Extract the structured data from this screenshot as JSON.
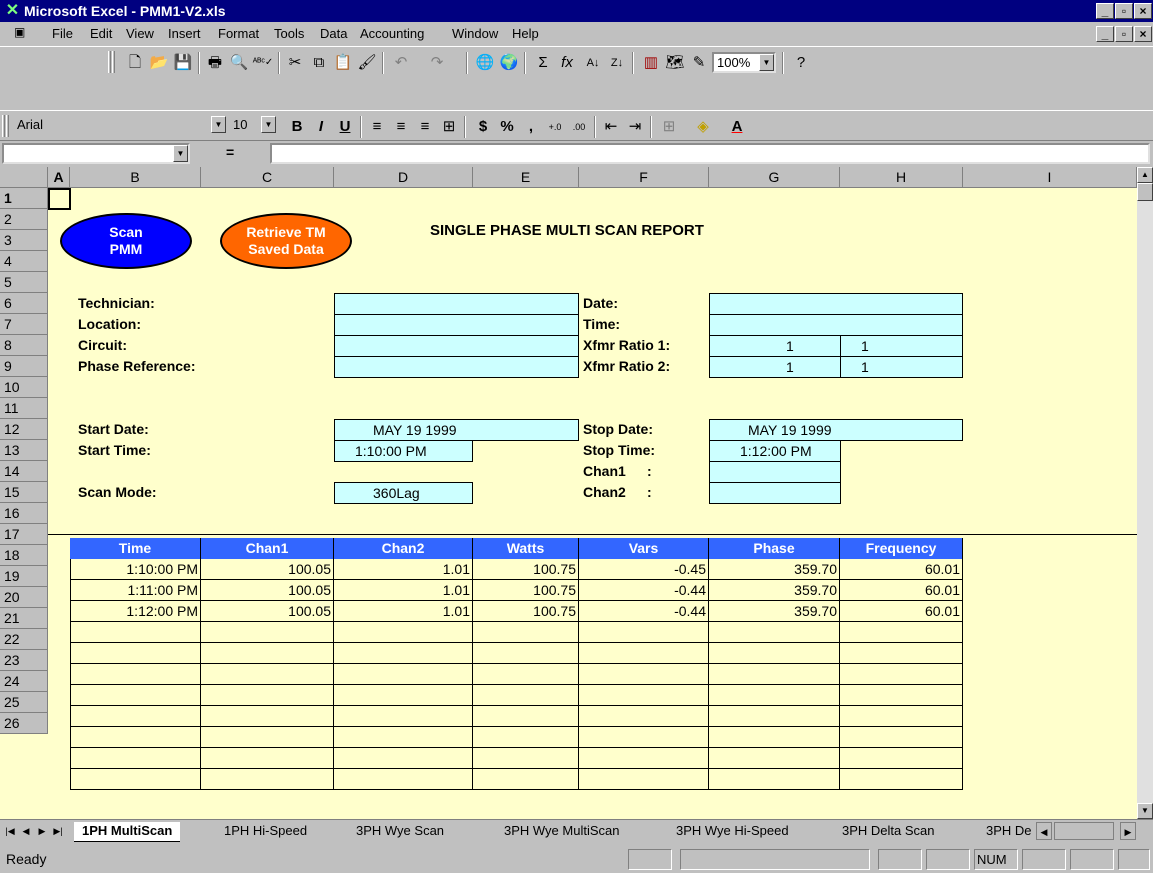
{
  "window": {
    "title": "Microsoft Excel - PMM1-V2.xls"
  },
  "menu": [
    "File",
    "Edit",
    "View",
    "Insert",
    "Format",
    "Tools",
    "Data",
    "Accounting",
    "Window",
    "Help"
  ],
  "format_toolbar": {
    "font": "Arial",
    "size": "10",
    "zoom": "100%"
  },
  "formula_bar": {
    "name_box": "",
    "equals": "=",
    "content": ""
  },
  "columns": [
    "A",
    "B",
    "C",
    "D",
    "E",
    "F",
    "G",
    "H",
    "I"
  ],
  "rows": [
    "1",
    "2",
    "3",
    "4",
    "5",
    "6",
    "7",
    "8",
    "9",
    "10",
    "11",
    "12",
    "13",
    "14",
    "15",
    "16",
    "17",
    "18",
    "19",
    "20",
    "21",
    "22",
    "23",
    "24",
    "25",
    "26"
  ],
  "buttons": {
    "scan": [
      "Scan",
      "PMM"
    ],
    "retrieve": [
      "Retrieve TM",
      "Saved Data"
    ]
  },
  "report": {
    "title": "SINGLE PHASE MULTI SCAN REPORT",
    "technician_label": "Technician:",
    "location_label": "Location:",
    "circuit_label": "Circuit:",
    "phase_ref_label": "Phase Reference:",
    "date_label": "Date:",
    "time_label": "Time:",
    "xfmr1_label": "Xfmr Ratio 1:",
    "xfmr2_label": "Xfmr Ratio 2:",
    "xfmr1_a": "1",
    "xfmr1_b": "1",
    "xfmr2_a": "1",
    "xfmr2_b": "1",
    "start_date_label": "Start Date:",
    "start_date": "MAY 19 1999",
    "start_time_label": "Start Time:",
    "start_time": "1:10:00 PM",
    "stop_date_label": "Stop Date:",
    "stop_date": "MAY 19 1999",
    "stop_time_label": "Stop Time:",
    "stop_time": "1:12:00 PM",
    "chan1_label": "Chan1",
    "chan2_label": "Chan2",
    "colon": ":",
    "scan_mode_label": "Scan Mode:",
    "scan_mode": "360Lag"
  },
  "table": {
    "headers": [
      "Time",
      "Chan1",
      "Chan2",
      "Watts",
      "Vars",
      "Phase",
      "Frequency"
    ],
    "rows": [
      [
        "1:10:00 PM",
        "100.05",
        "1.01",
        "100.75",
        "-0.45",
        "359.70",
        "60.01"
      ],
      [
        "1:11:00 PM",
        "100.05",
        "1.01",
        "100.75",
        "-0.44",
        "359.70",
        "60.01"
      ],
      [
        "1:12:00 PM",
        "100.05",
        "1.01",
        "100.75",
        "-0.44",
        "359.70",
        "60.01"
      ]
    ]
  },
  "tabs": [
    "1PH MultiScan",
    "1PH Hi-Speed",
    "3PH Wye Scan",
    "3PH Wye MultiScan",
    "3PH Wye Hi-Speed",
    "3PH Delta Scan",
    "3PH De"
  ],
  "status": {
    "text": "Ready",
    "num": "NUM"
  }
}
